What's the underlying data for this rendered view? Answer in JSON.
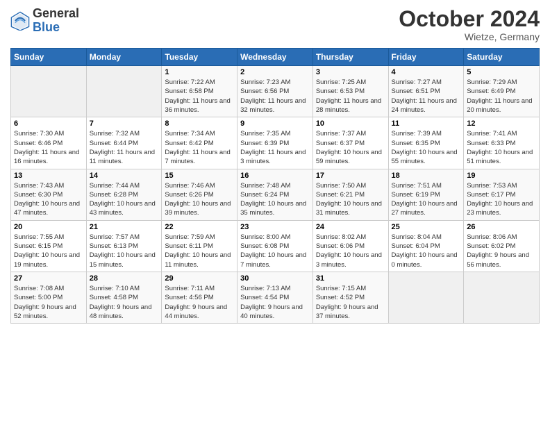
{
  "logo": {
    "general": "General",
    "blue": "Blue"
  },
  "title": "October 2024",
  "location": "Wietze, Germany",
  "days_header": [
    "Sunday",
    "Monday",
    "Tuesday",
    "Wednesday",
    "Thursday",
    "Friday",
    "Saturday"
  ],
  "weeks": [
    [
      {
        "day": "",
        "sunrise": "",
        "sunset": "",
        "daylight": ""
      },
      {
        "day": "",
        "sunrise": "",
        "sunset": "",
        "daylight": ""
      },
      {
        "day": "1",
        "sunrise": "Sunrise: 7:22 AM",
        "sunset": "Sunset: 6:58 PM",
        "daylight": "Daylight: 11 hours and 36 minutes."
      },
      {
        "day": "2",
        "sunrise": "Sunrise: 7:23 AM",
        "sunset": "Sunset: 6:56 PM",
        "daylight": "Daylight: 11 hours and 32 minutes."
      },
      {
        "day": "3",
        "sunrise": "Sunrise: 7:25 AM",
        "sunset": "Sunset: 6:53 PM",
        "daylight": "Daylight: 11 hours and 28 minutes."
      },
      {
        "day": "4",
        "sunrise": "Sunrise: 7:27 AM",
        "sunset": "Sunset: 6:51 PM",
        "daylight": "Daylight: 11 hours and 24 minutes."
      },
      {
        "day": "5",
        "sunrise": "Sunrise: 7:29 AM",
        "sunset": "Sunset: 6:49 PM",
        "daylight": "Daylight: 11 hours and 20 minutes."
      }
    ],
    [
      {
        "day": "6",
        "sunrise": "Sunrise: 7:30 AM",
        "sunset": "Sunset: 6:46 PM",
        "daylight": "Daylight: 11 hours and 16 minutes."
      },
      {
        "day": "7",
        "sunrise": "Sunrise: 7:32 AM",
        "sunset": "Sunset: 6:44 PM",
        "daylight": "Daylight: 11 hours and 11 minutes."
      },
      {
        "day": "8",
        "sunrise": "Sunrise: 7:34 AM",
        "sunset": "Sunset: 6:42 PM",
        "daylight": "Daylight: 11 hours and 7 minutes."
      },
      {
        "day": "9",
        "sunrise": "Sunrise: 7:35 AM",
        "sunset": "Sunset: 6:39 PM",
        "daylight": "Daylight: 11 hours and 3 minutes."
      },
      {
        "day": "10",
        "sunrise": "Sunrise: 7:37 AM",
        "sunset": "Sunset: 6:37 PM",
        "daylight": "Daylight: 10 hours and 59 minutes."
      },
      {
        "day": "11",
        "sunrise": "Sunrise: 7:39 AM",
        "sunset": "Sunset: 6:35 PM",
        "daylight": "Daylight: 10 hours and 55 minutes."
      },
      {
        "day": "12",
        "sunrise": "Sunrise: 7:41 AM",
        "sunset": "Sunset: 6:33 PM",
        "daylight": "Daylight: 10 hours and 51 minutes."
      }
    ],
    [
      {
        "day": "13",
        "sunrise": "Sunrise: 7:43 AM",
        "sunset": "Sunset: 6:30 PM",
        "daylight": "Daylight: 10 hours and 47 minutes."
      },
      {
        "day": "14",
        "sunrise": "Sunrise: 7:44 AM",
        "sunset": "Sunset: 6:28 PM",
        "daylight": "Daylight: 10 hours and 43 minutes."
      },
      {
        "day": "15",
        "sunrise": "Sunrise: 7:46 AM",
        "sunset": "Sunset: 6:26 PM",
        "daylight": "Daylight: 10 hours and 39 minutes."
      },
      {
        "day": "16",
        "sunrise": "Sunrise: 7:48 AM",
        "sunset": "Sunset: 6:24 PM",
        "daylight": "Daylight: 10 hours and 35 minutes."
      },
      {
        "day": "17",
        "sunrise": "Sunrise: 7:50 AM",
        "sunset": "Sunset: 6:21 PM",
        "daylight": "Daylight: 10 hours and 31 minutes."
      },
      {
        "day": "18",
        "sunrise": "Sunrise: 7:51 AM",
        "sunset": "Sunset: 6:19 PM",
        "daylight": "Daylight: 10 hours and 27 minutes."
      },
      {
        "day": "19",
        "sunrise": "Sunrise: 7:53 AM",
        "sunset": "Sunset: 6:17 PM",
        "daylight": "Daylight: 10 hours and 23 minutes."
      }
    ],
    [
      {
        "day": "20",
        "sunrise": "Sunrise: 7:55 AM",
        "sunset": "Sunset: 6:15 PM",
        "daylight": "Daylight: 10 hours and 19 minutes."
      },
      {
        "day": "21",
        "sunrise": "Sunrise: 7:57 AM",
        "sunset": "Sunset: 6:13 PM",
        "daylight": "Daylight: 10 hours and 15 minutes."
      },
      {
        "day": "22",
        "sunrise": "Sunrise: 7:59 AM",
        "sunset": "Sunset: 6:11 PM",
        "daylight": "Daylight: 10 hours and 11 minutes."
      },
      {
        "day": "23",
        "sunrise": "Sunrise: 8:00 AM",
        "sunset": "Sunset: 6:08 PM",
        "daylight": "Daylight: 10 hours and 7 minutes."
      },
      {
        "day": "24",
        "sunrise": "Sunrise: 8:02 AM",
        "sunset": "Sunset: 6:06 PM",
        "daylight": "Daylight: 10 hours and 3 minutes."
      },
      {
        "day": "25",
        "sunrise": "Sunrise: 8:04 AM",
        "sunset": "Sunset: 6:04 PM",
        "daylight": "Daylight: 10 hours and 0 minutes."
      },
      {
        "day": "26",
        "sunrise": "Sunrise: 8:06 AM",
        "sunset": "Sunset: 6:02 PM",
        "daylight": "Daylight: 9 hours and 56 minutes."
      }
    ],
    [
      {
        "day": "27",
        "sunrise": "Sunrise: 7:08 AM",
        "sunset": "Sunset: 5:00 PM",
        "daylight": "Daylight: 9 hours and 52 minutes."
      },
      {
        "day": "28",
        "sunrise": "Sunrise: 7:10 AM",
        "sunset": "Sunset: 4:58 PM",
        "daylight": "Daylight: 9 hours and 48 minutes."
      },
      {
        "day": "29",
        "sunrise": "Sunrise: 7:11 AM",
        "sunset": "Sunset: 4:56 PM",
        "daylight": "Daylight: 9 hours and 44 minutes."
      },
      {
        "day": "30",
        "sunrise": "Sunrise: 7:13 AM",
        "sunset": "Sunset: 4:54 PM",
        "daylight": "Daylight: 9 hours and 40 minutes."
      },
      {
        "day": "31",
        "sunrise": "Sunrise: 7:15 AM",
        "sunset": "Sunset: 4:52 PM",
        "daylight": "Daylight: 9 hours and 37 minutes."
      },
      {
        "day": "",
        "sunrise": "",
        "sunset": "",
        "daylight": ""
      },
      {
        "day": "",
        "sunrise": "",
        "sunset": "",
        "daylight": ""
      }
    ]
  ]
}
